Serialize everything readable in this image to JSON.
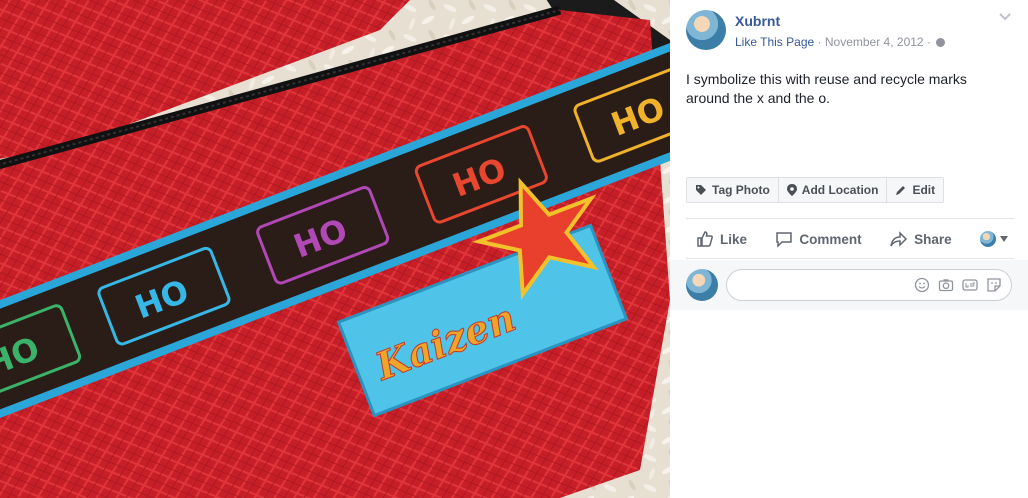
{
  "photo": {
    "patch_text": "Kaizen",
    "ribbon_text": "HO"
  },
  "post": {
    "page_name": "Xubrnt",
    "like_page": "Like This Page",
    "separator": "·",
    "date": "November 4, 2012",
    "text": "I symbolize this with reuse and recycle marks around the x and the o."
  },
  "photo_actions": {
    "tag_photo": "Tag Photo",
    "add_location": "Add Location",
    "edit": "Edit"
  },
  "reactions": {
    "like": "Like",
    "comment": "Comment",
    "share": "Share"
  },
  "comment": {
    "placeholder": ""
  },
  "colors": {
    "link": "#365899",
    "meta": "#90949c",
    "text": "#1d2129",
    "bag_red": "#c8202a",
    "ribbon_blue": "#2aa6d9",
    "ribbon_brown": "#2a1c16"
  },
  "icons": [
    "chevron-down-icon",
    "globe-icon",
    "tag-icon",
    "location-pin-icon",
    "pencil-icon",
    "thumbs-up-icon",
    "comment-bubble-icon",
    "share-arrow-icon",
    "emoji-icon",
    "camera-icon",
    "gif-icon",
    "sticker-icon"
  ]
}
